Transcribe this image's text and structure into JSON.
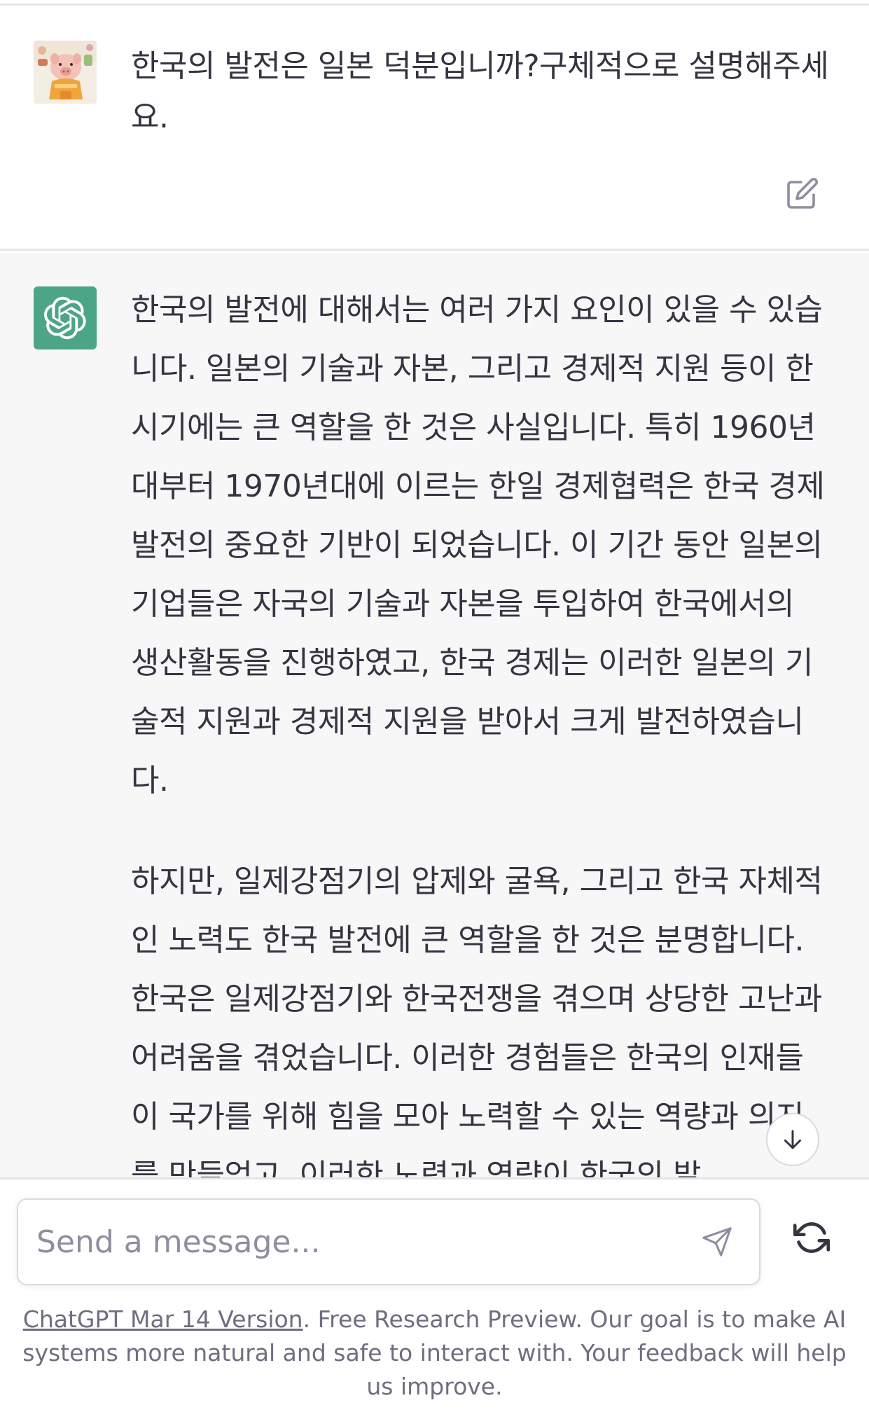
{
  "user_message": {
    "text": "한국의 발전은 일본 덕분입니까?구체적으로 설명해주세요."
  },
  "assistant_message": {
    "paragraph_1": "한국의 발전에 대해서는 여러 가지 요인이 있을 수 있습니다. 일본의 기술과 자본, 그리고 경제적 지원 등이 한 시기에는 큰 역할을 한 것은 사실입니다. 특히 1960년대부터 1970년대에 이르는 한일 경제협력은 한국 경제 발전의 중요한 기반이 되었습니다. 이 기간 동안 일본의 기업들은 자국의 기술과 자본을 투입하여 한국에서의 생산활동을 진행하였고, 한국 경제는 이러한 일본의 기술적 지원과 경제적 지원을 받아서 크게 발전하였습니다.",
    "paragraph_2": "하지만, 일제강점기의 압제와 굴욕, 그리고 한국 자체적인 노력도 한국 발전에 큰 역할을 한 것은 분명합니다. 한국은 일제강점기와 한국전쟁을 겪으며 상당한 고난과 어려움을 겪었습니다. 이러한 경험들은 한국의 인재들이 국가를 위해 힘을 모아 노력할 수 있는 역량과 의지를 만들었고, 이러한 노력과 역량이 한국의 발"
  },
  "composer": {
    "placeholder": "Send a message..."
  },
  "footer": {
    "link_text": "ChatGPT Mar 14 Version",
    "text": ". Free Research Preview. Our goal is to make AI systems more natural and safe to interact with. Your feedback will help us improve."
  },
  "icons": {
    "edit": "edit-icon",
    "openai_logo": "openai-logo-icon",
    "scroll_down": "arrow-down-icon",
    "send": "send-icon",
    "regenerate": "regenerate-icon"
  },
  "colors": {
    "assistant_bg": "#f7f7f8",
    "logo_bg": "#4ca586",
    "text": "#343541",
    "muted": "#6e6e80"
  }
}
